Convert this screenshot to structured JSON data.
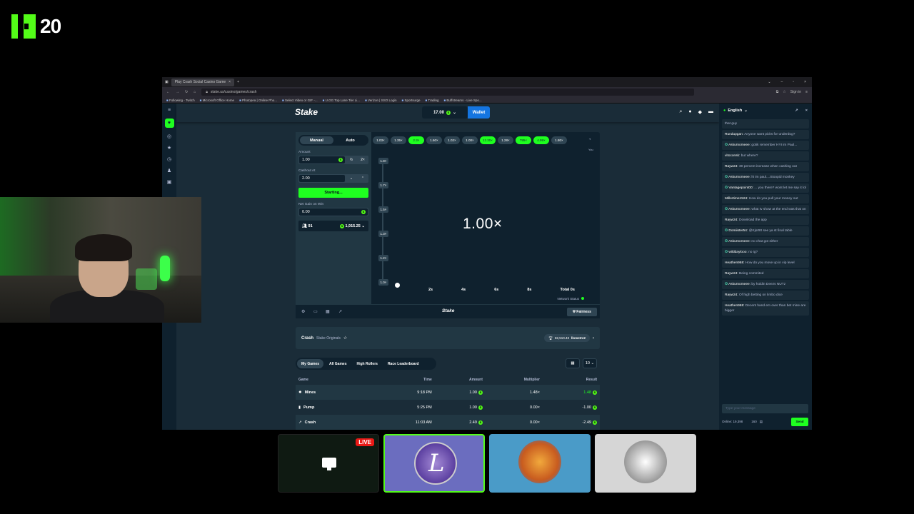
{
  "overlay": {
    "viewer_count": "20"
  },
  "browser": {
    "tab_title": "Play Crash Social Casino Game",
    "new_tab": "+",
    "url": "stake.us/casino/games/crash",
    "sign_in": "Sign in",
    "bookmarks": [
      "Following - Twitch",
      "Microsoft Office Home",
      "Photopea | Online Pho...",
      "Select Video or GIF -...",
      "U.GG Top Lane Tier Li...",
      "Verizon | SSO Login",
      "Sportsurge",
      "Trading",
      "Buffstreams - Live Spo..."
    ]
  },
  "topnav": {
    "logo": "Stake",
    "balance": "17.00",
    "wallet": "Wallet"
  },
  "controls": {
    "mode_manual": "Manual",
    "mode_auto": "Auto",
    "amount_label": "Amount",
    "amount_value": "1.00",
    "half": "½",
    "double": "2×",
    "cashout_label": "Cashout At",
    "cashout_value": "2.00",
    "start_button": "Starting...",
    "net_gain_label": "Net Gain on Win",
    "net_gain_value": "0.00",
    "players": "91",
    "total_bet": "1,915.25"
  },
  "history": [
    {
      "v": "1.03×",
      "win": false
    },
    {
      "v": "1.35×",
      "win": false
    },
    {
      "v": "2.3×",
      "win": true
    },
    {
      "v": "1.60×",
      "win": false
    },
    {
      "v": "1.02×",
      "win": false
    },
    {
      "v": "1.00×",
      "win": false
    },
    {
      "v": "12.30×",
      "win": true
    },
    {
      "v": "1.28×",
      "win": false
    },
    {
      "v": "795×",
      "win": true
    },
    {
      "v": "4.99×",
      "win": true
    },
    {
      "v": "1.80×",
      "win": false
    }
  ],
  "history_you": "You",
  "graph": {
    "y_ticks": [
      "1.8×",
      "1.7×",
      "1.5×",
      "1.3×",
      "1.2×",
      "1.0×"
    ],
    "x_ticks": [
      "2s",
      "4s",
      "6s",
      "8s",
      "Total 0s"
    ],
    "multiplier": "1.00×",
    "network_status": "Network Status"
  },
  "gamefoot": {
    "logo": "Stake",
    "fairness": "Fairness"
  },
  "crashinfo": {
    "title": "Crash",
    "subtitle": "Stake Originals",
    "leader": "82,510.43",
    "leader_name": "llometre2"
  },
  "table": {
    "tabs": [
      "My Games",
      "All Games",
      "High Rollers",
      "Race Leaderboard"
    ],
    "rows_per_page": "10",
    "headers": [
      "Game",
      "Time",
      "Amount",
      "Multiplier",
      "Result"
    ],
    "rows": [
      {
        "game": "Mines",
        "time": "9:18 PM",
        "amount": "1.00",
        "multiplier": "1.48×",
        "result": "1.48"
      },
      {
        "game": "Pump",
        "time": "5:25 PM",
        "amount": "1.00",
        "multiplier": "0.00×",
        "result": "-1.00"
      },
      {
        "game": "Crash",
        "time": "11:03 AM",
        "amount": "2.49",
        "multiplier": "0.00×",
        "result": "-2.49"
      }
    ]
  },
  "chat": {
    "language": "English",
    "messages": [
      {
        "user": "",
        "text": "that guy",
        "star": false
      },
      {
        "user": "Rundupgan:",
        "text": "Anyone want picks for underdog?",
        "star": false
      },
      {
        "user": "Askurnomeee:",
        "text": "gotik remember HYI im Paul...",
        "star": true
      },
      {
        "user": "vitoconsk:",
        "text": "but where?",
        "star": false
      },
      {
        "user": "Rayw24:",
        "text": "30 percent increase when cashing out",
        "star": false
      },
      {
        "user": "Askurnomeee:",
        "text": "hi im paul....Stoopid monkey",
        "star": true
      },
      {
        "user": "Vantagepoint00:",
        "text": "... you there? wont let me say it lol",
        "star": true
      },
      {
        "user": "Millertime1524:",
        "text": "How do you pull your money out",
        "star": false
      },
      {
        "user": "Askurnomeee:",
        "text": "what tv show at the end was that on",
        "star": true
      },
      {
        "user": "Rayw24:",
        "text": "Download the app",
        "star": false
      },
      {
        "user": "Domiister54:",
        "text": "@Kjsr90 see ya st final table",
        "star": true
      },
      {
        "user": "Askurnomeee:",
        "text": "no chat got either",
        "star": true
      },
      {
        "user": "wilddaylooo:",
        "text": "no ig?",
        "star": true
      },
      {
        "user": "Heathen968:",
        "text": "How do you move up in vip level",
        "star": false
      },
      {
        "user": "Rayw24:",
        "text": "Being commited",
        "star": false
      },
      {
        "user": "Askurnomeee:",
        "text": "by holdin Deezs NUTz",
        "star": true
      },
      {
        "user": "Rayw24:",
        "text": "Of high betting on limbo dice",
        "star": false
      },
      {
        "user": "Heathen968:",
        "text": "Decent hand em over than bet mine are bigger",
        "star": false
      }
    ],
    "placeholder": "Type your message",
    "online": "Online: 19,398",
    "count": "160",
    "send": "Send"
  },
  "live_badge": "LIVE",
  "colors": {
    "accent": "#1fff20",
    "bg": "#0f212e",
    "panel": "#213743",
    "kick": "#53fc18"
  }
}
